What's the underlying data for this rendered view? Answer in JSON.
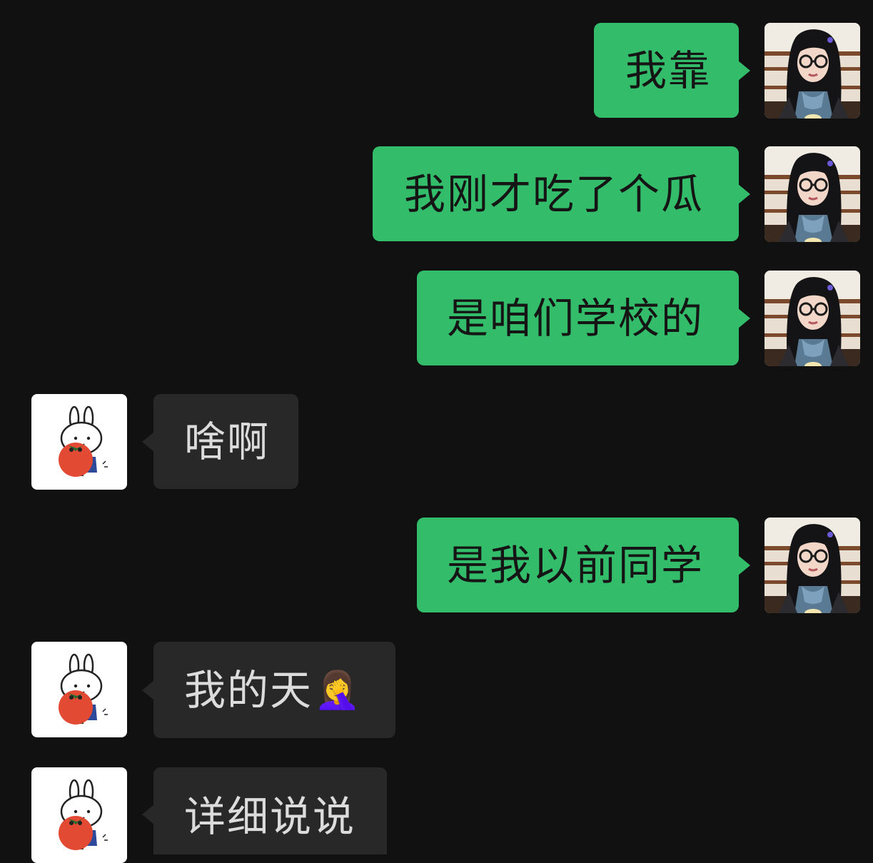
{
  "conversation": {
    "messages": [
      {
        "side": "sent",
        "sender": "me",
        "text": "我靠"
      },
      {
        "side": "sent",
        "sender": "me",
        "text": "我刚才吃了个瓜"
      },
      {
        "side": "sent",
        "sender": "me",
        "text": "是咱们学校的"
      },
      {
        "side": "received",
        "sender": "friend",
        "text": "啥啊"
      },
      {
        "side": "sent",
        "sender": "me",
        "text": "是我以前同学"
      },
      {
        "side": "received",
        "sender": "friend",
        "text": "我的天",
        "emoji": "🤦‍♀️"
      },
      {
        "side": "received",
        "sender": "friend",
        "text": "详细说说"
      }
    ]
  },
  "avatars": {
    "me": {
      "icon": "girl-with-glasses-photo-avatar"
    },
    "friend": {
      "icon": "rabbit-holding-tomato-avatar"
    }
  },
  "colors": {
    "background": "#111111",
    "sent_bubble": "#33bd6b",
    "received_bubble": "#282828",
    "sent_text": "#151515",
    "received_text": "#dcdcdc"
  }
}
